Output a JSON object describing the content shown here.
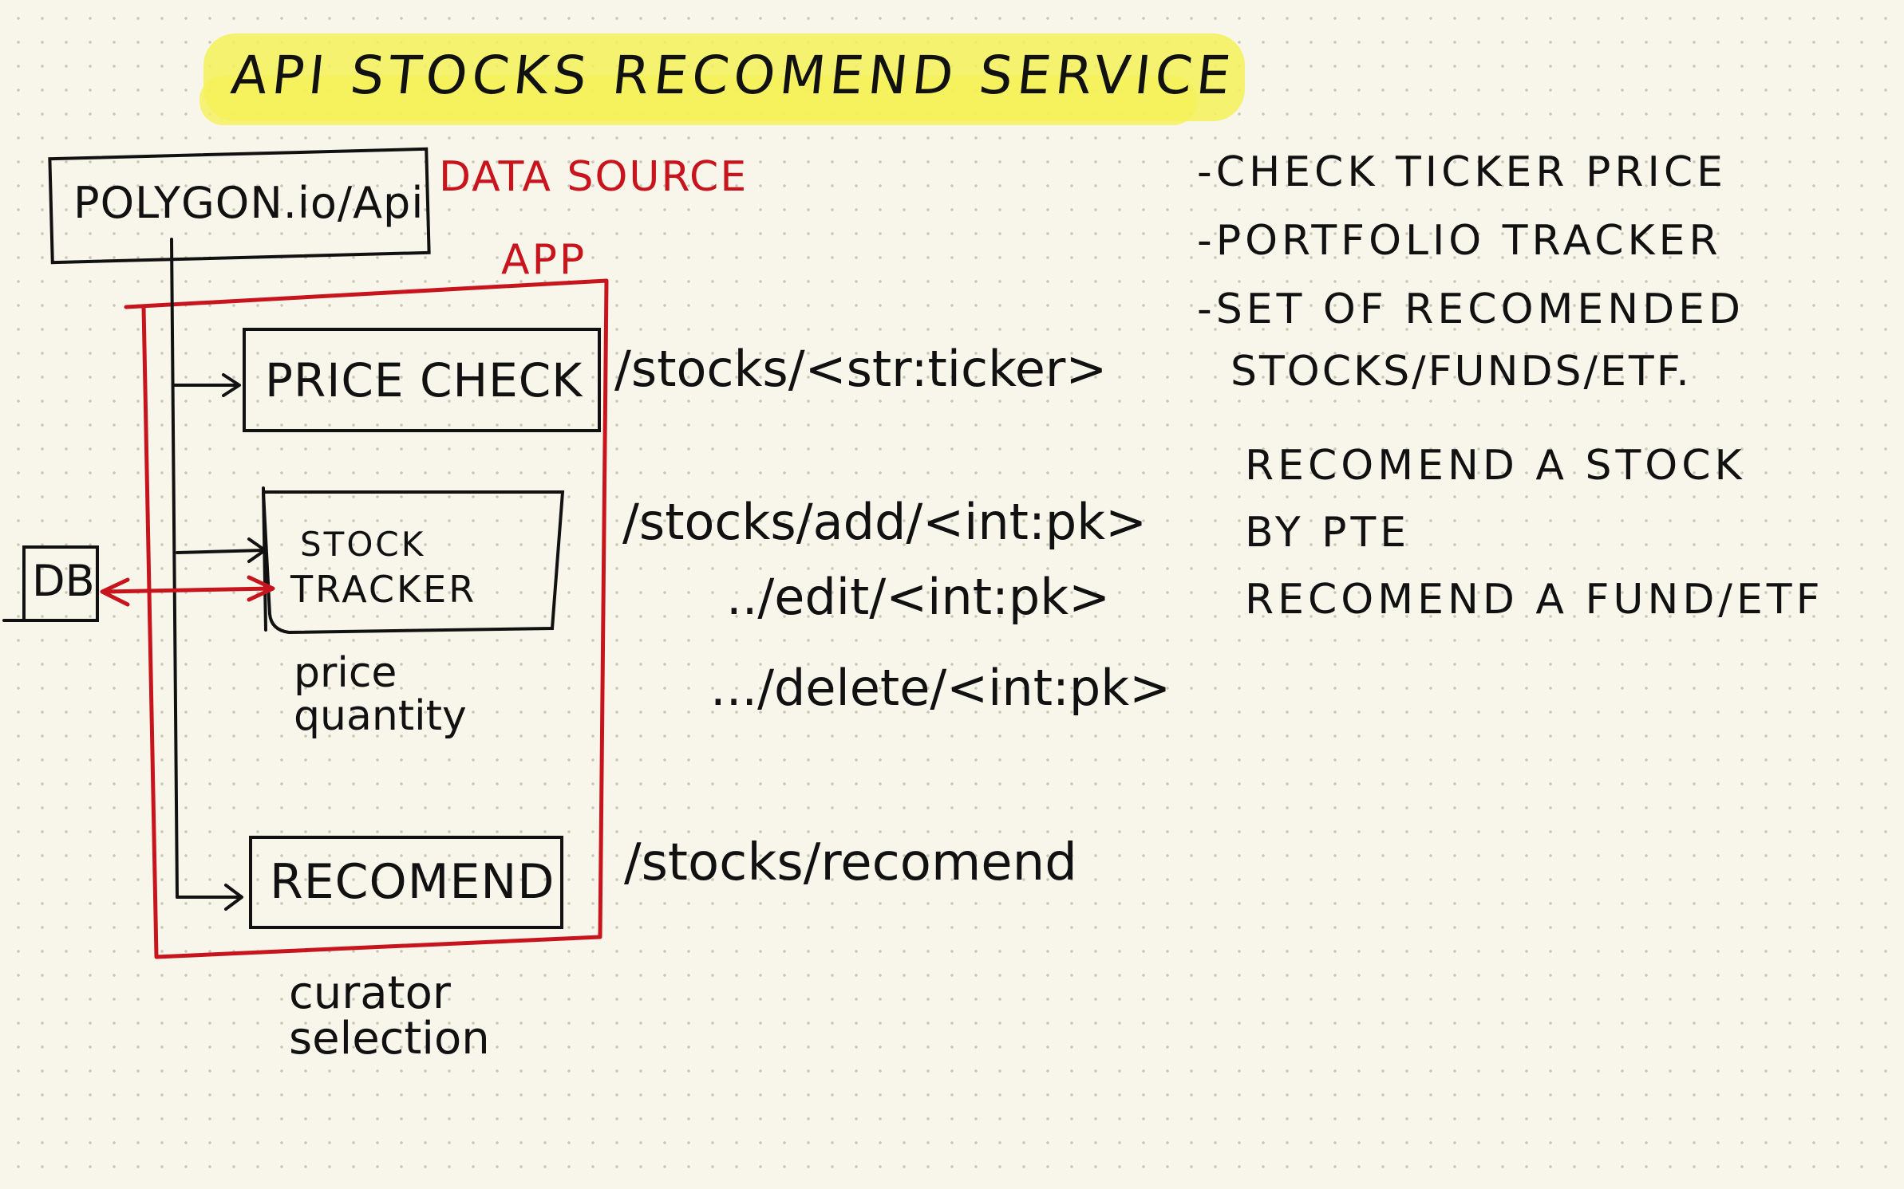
{
  "colors": {
    "ink": "#111111",
    "accent_red": "#c8141c",
    "highlight_yellow": "#f5f15a",
    "paper": "#f8f6ea"
  },
  "title": "API STOCKS RECOMEND SERVICE",
  "data_source": {
    "box_label": "POLYGON.io/Api",
    "annotation": "DATA SOURCE"
  },
  "app": {
    "label": "APP",
    "db_label": "DB",
    "modules": {
      "price_check": "PRICE CHECK",
      "stock_tracker_line1": "STOCK",
      "stock_tracker_line2": "TRACKER",
      "recomend": "RECOMEND"
    },
    "tracker_fields": [
      "price",
      "quantity"
    ],
    "recomend_notes": [
      "curator",
      "selection"
    ]
  },
  "endpoints": {
    "price_check": "/stocks/<str:ticker>",
    "tracker_add": "/stocks/add/<int:pk>",
    "tracker_edit": "../edit/<int:pk>",
    "tracker_delete": ".../delete/<int:pk>",
    "recomend": "/stocks/recomend"
  },
  "features": [
    "-CHECK TICKER PRICE",
    "-PORTFOLIO TRACKER",
    "-SET OF RECOMENDED",
    "STOCKS/FUNDS/ETF."
  ],
  "recomend_details": [
    "RECOMEND A STOCK",
    "BY PTE",
    "RECOMEND A FUND/ETF"
  ]
}
